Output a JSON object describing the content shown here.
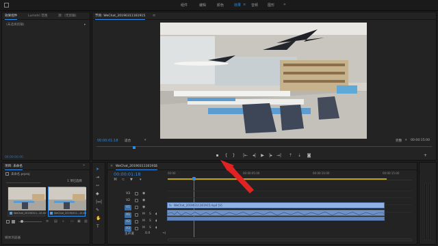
{
  "workspaces": [
    "组件",
    "编辑",
    "颜色",
    "效果",
    "音频",
    "图形"
  ],
  "active_workspace_index": 3,
  "source_panel": {
    "tabs": [
      "效果控件",
      "Lumetri 范围",
      "源：(无剪辑)"
    ],
    "no_clip_label": "(未选择剪辑)",
    "timecode": "00:00:00:00"
  },
  "program_monitor": {
    "title": "节目: WeChat_20190311161915",
    "current_time": "00:00:01:18",
    "fit": "适合",
    "quality": "完整",
    "duration": "00:00:15:00"
  },
  "project_panel": {
    "tabs": [
      "项目: 未命名",
      "媒体浏览器"
    ],
    "filename": "未命名.prproj",
    "selection": "1 项已选择",
    "items": [
      {
        "name": "WeChat_20190311...",
        "duration": "15:00"
      },
      {
        "name": "WeChat_20190311...",
        "duration": "15:00"
      }
    ]
  },
  "timeline": {
    "tab": "WeChat_20190311161915",
    "timecode": "00:00:01:18",
    "ruler": [
      "00:00",
      "00:00:05:00",
      "00:00:10:00",
      "00:00:15:00"
    ],
    "video_tracks": [
      "V3",
      "V2",
      "V1"
    ],
    "audio_tracks": [
      "A1",
      "A2",
      "A3"
    ],
    "master_label": "主声道",
    "master_value": "0.0",
    "video_clip_label": "WeChat_20190311161915.mp4 [V]"
  },
  "colors": {
    "accent": "#2d8ceb",
    "annotation_arrow": "#e02222"
  }
}
